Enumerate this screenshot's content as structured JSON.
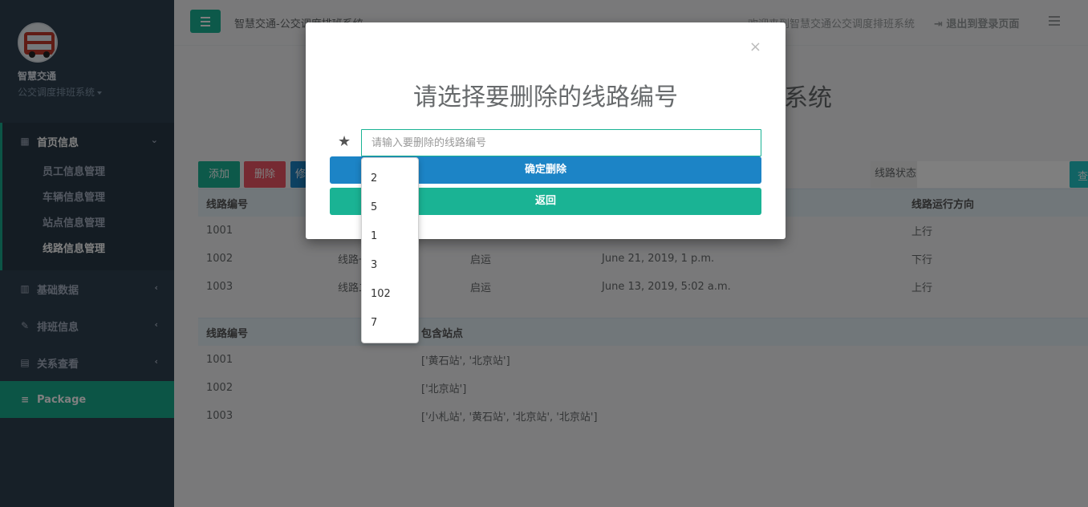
{
  "sidebar": {
    "profile_name": "智慧交通",
    "profile_role": "公交调度排班系统",
    "menu": {
      "home": "首页信息",
      "sub": [
        "员工信息管理",
        "车辆信息管理",
        "站点信息管理",
        "线路信息管理"
      ],
      "basic_data": "基础数据",
      "schedule": "排班信息",
      "relation": "关系查看",
      "package": "Package"
    }
  },
  "topbar": {
    "title": "智慧交通-公交调度排班系统",
    "welcome": "欢迎来到智慧交通公交调度排班系统",
    "logout": "退出到登录页面"
  },
  "main": {
    "heading_tail": "系统",
    "toolbar": {
      "add": "添加",
      "delete": "删除",
      "edit": "修",
      "status_label": "线路状态",
      "search": "查"
    },
    "table1": {
      "headers": {
        "c1": "线路编号",
        "c5": "线路运行方向"
      },
      "rows": [
        {
          "id": "1001",
          "name": "",
          "status": "",
          "date": "",
          "dir": "上行"
        },
        {
          "id": "1002",
          "name": "线路一",
          "status": "启运",
          "date": "June 21, 2019, 1 p.m.",
          "dir": "下行"
        },
        {
          "id": "1003",
          "name": "线路二",
          "status": "启运",
          "date": "June 13, 2019, 5:02 a.m.",
          "dir": "上行"
        }
      ]
    },
    "table2": {
      "headers": {
        "c1": "线路编号",
        "c2": "包含站点"
      },
      "rows": [
        {
          "id": "1001",
          "stations": "['黄石站', '北京站']"
        },
        {
          "id": "1002",
          "stations": "['北京站']"
        },
        {
          "id": "1003",
          "stations": "['小札站', '黄石站', '北京站', '北京站']"
        }
      ]
    }
  },
  "modal": {
    "close": "×",
    "title": "请选择要删除的线路编号",
    "star": "★",
    "input_placeholder": "请输入要删除的线路编号",
    "confirm": "确定删除",
    "back": "返回",
    "options": [
      "2",
      "5",
      "1",
      "3",
      "102",
      "7"
    ]
  }
}
